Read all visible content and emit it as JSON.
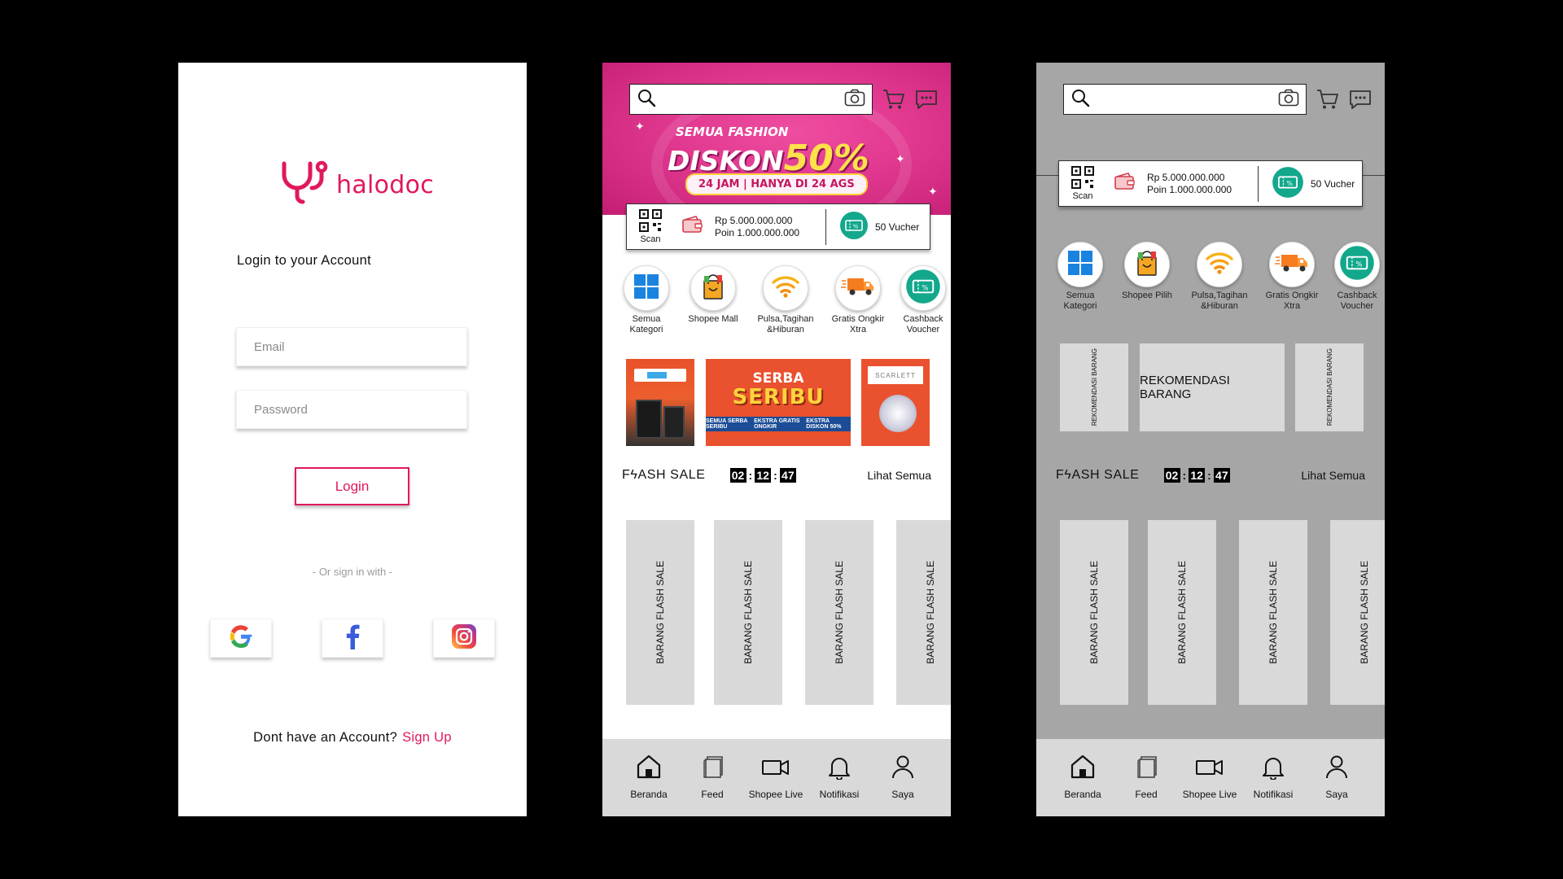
{
  "login": {
    "logo_text": "halodoc",
    "title": "Login to your Account",
    "email_placeholder": "Email",
    "password_placeholder": "Password",
    "login_label": "Login",
    "or_sign_in": "- Or sign in with -",
    "signup_prompt": "Dont have an Account?",
    "signup_link": "Sign Up",
    "brand_color": "#e0195a"
  },
  "shop": {
    "banner": {
      "line1": "SEMUA FASHION",
      "line2": "DISKON",
      "line2_pct": "50%",
      "line3": "24 JAM | HANYA DI 24 AGS"
    },
    "scan_label": "Scan",
    "balance": "Rp 5.000.000.000",
    "points": "Poin 1.000.000.000",
    "voucher": "50 Vucher",
    "categories": [
      {
        "label": "Semua\nKategori",
        "icon": "windows-grid-icon"
      },
      {
        "label": "Shopee Mall",
        "icon": "shopping-bag-icon"
      },
      {
        "label": "Pulsa,Tagihan\n&Hiburan",
        "icon": "wifi-icon"
      },
      {
        "label": "Gratis Ongkir\nXtra",
        "icon": "delivery-truck-icon"
      },
      {
        "label": "Cashback\nVoucher",
        "icon": "voucher-icon"
      }
    ],
    "promo": {
      "serba1": "SERBA",
      "serba2": "SERIBU",
      "strip1": "SEMUA SERBA SERIBU",
      "strip2": "EKSTRA GRATIS ONGKIR",
      "strip3": "EKSTRA DISKON 50%",
      "scarlett": "SCARLETT"
    },
    "flash_title": "FϟASH SALE",
    "timer": [
      "02",
      "12",
      "47"
    ],
    "see_all": "Lihat Semua",
    "flash_item": "BARANG FLASH SALE",
    "nav": [
      {
        "label": "Beranda",
        "icon": "home-icon"
      },
      {
        "label": "Feed",
        "icon": "feed-icon"
      },
      {
        "label": "Shopee Live",
        "icon": "video-camera-icon"
      },
      {
        "label": "Notifikasi",
        "icon": "bell-icon"
      },
      {
        "label": "Saya",
        "icon": "user-icon"
      }
    ]
  },
  "wire": {
    "categories": [
      {
        "label": "Semua\nKategori"
      },
      {
        "label": "Shopee Pilih"
      },
      {
        "label": "Pulsa,Tagihan\n&Hiburan"
      },
      {
        "label": "Gratis Ongkir\nXtra"
      },
      {
        "label": "Cashback\nVoucher"
      }
    ],
    "rec_small": "REKOMENDASI BARANG",
    "rec_main": "REKOMENDASI BARANG"
  }
}
